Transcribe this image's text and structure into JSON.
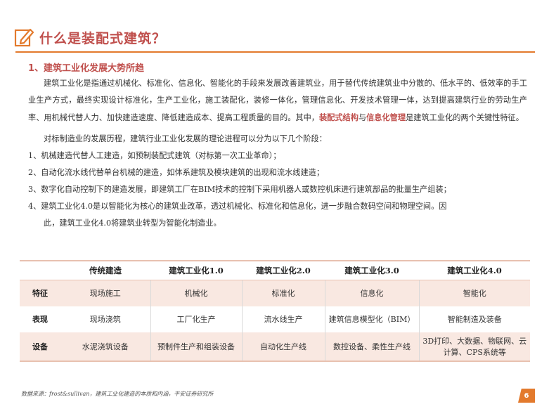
{
  "title": "什么是装配式建筑？",
  "section_heading": "1、建筑工业化发展大势所趋",
  "intro": {
    "text_before": "建筑工业化是指通过机械化、标准化、信息化、智能化的手段来发展改善建筑业，用于替代传统建筑业中分散的、低水平的、低效率的手工业生产方式，最终实现设计标准化，生产工业化，施工装配化，装修一体化，管理信息化、开发技术管理一体，达到提高建筑行业的劳动生产率、用机械代替人力、加快建造速度、降低建造成本、提高工程质量的目的。其中，",
    "highlight1": "装配式结构",
    "connector": "与",
    "highlight2": "信息化管理",
    "text_after": "是建筑工业化的两个关键性特征。"
  },
  "stages_intro": "对标制造业的发展历程，建筑行业工业化发展的理论进程可以分为以下几个阶段：",
  "stages": [
    "1、机械建造代替人工建造，如预制装配式建筑（对标第一次工业革命）；",
    "2、自动化流水线代替单台机械的建造，如体系建筑及模块建筑的出现和流水线建造；",
    "3、数字化自动控制下的建造发展，即建筑工厂在BIM技术的控制下采用机器人或数控机床进行建筑部品的批量生产组装；",
    "4、建筑工业化4.0是以智能化为核心的建筑业改革，透过机械化、标准化和信息化，进一步融合数码空间和物理空间。因",
    "此，建筑工业化4.0将建筑业转型为智能化制造业。"
  ],
  "table": {
    "headers": [
      "",
      "传统建造",
      "建筑工业化1.0",
      "建筑工业化2.0",
      "建筑工业化3.0",
      "建筑工业化4.0"
    ],
    "rows": [
      {
        "label": "特征",
        "cells": [
          "现场施工",
          "机械化",
          "标准化",
          "信息化",
          "智能化"
        ]
      },
      {
        "label": "表现",
        "cells": [
          "现场浇筑",
          "工厂化生产",
          "流水线生产",
          "建筑信息模型化（BIM）",
          "智能制造及装备"
        ]
      },
      {
        "label": "设备",
        "cells": [
          "水泥浇筑设备",
          "预制件生产和组装设备",
          "自动化生产线",
          "数控设备、柔性生产线",
          "3D打印、大数据、物联网、云计算、CPS系统等"
        ]
      }
    ]
  },
  "source": "数据来源：frost&sullivan，建筑工业化建造的本质和内涵，平安证券研究所",
  "page_number": "6",
  "colors": {
    "accent_red": "#c0504d",
    "accent_orange": "#e37a2d",
    "row_shade": "#f9e8e1"
  }
}
